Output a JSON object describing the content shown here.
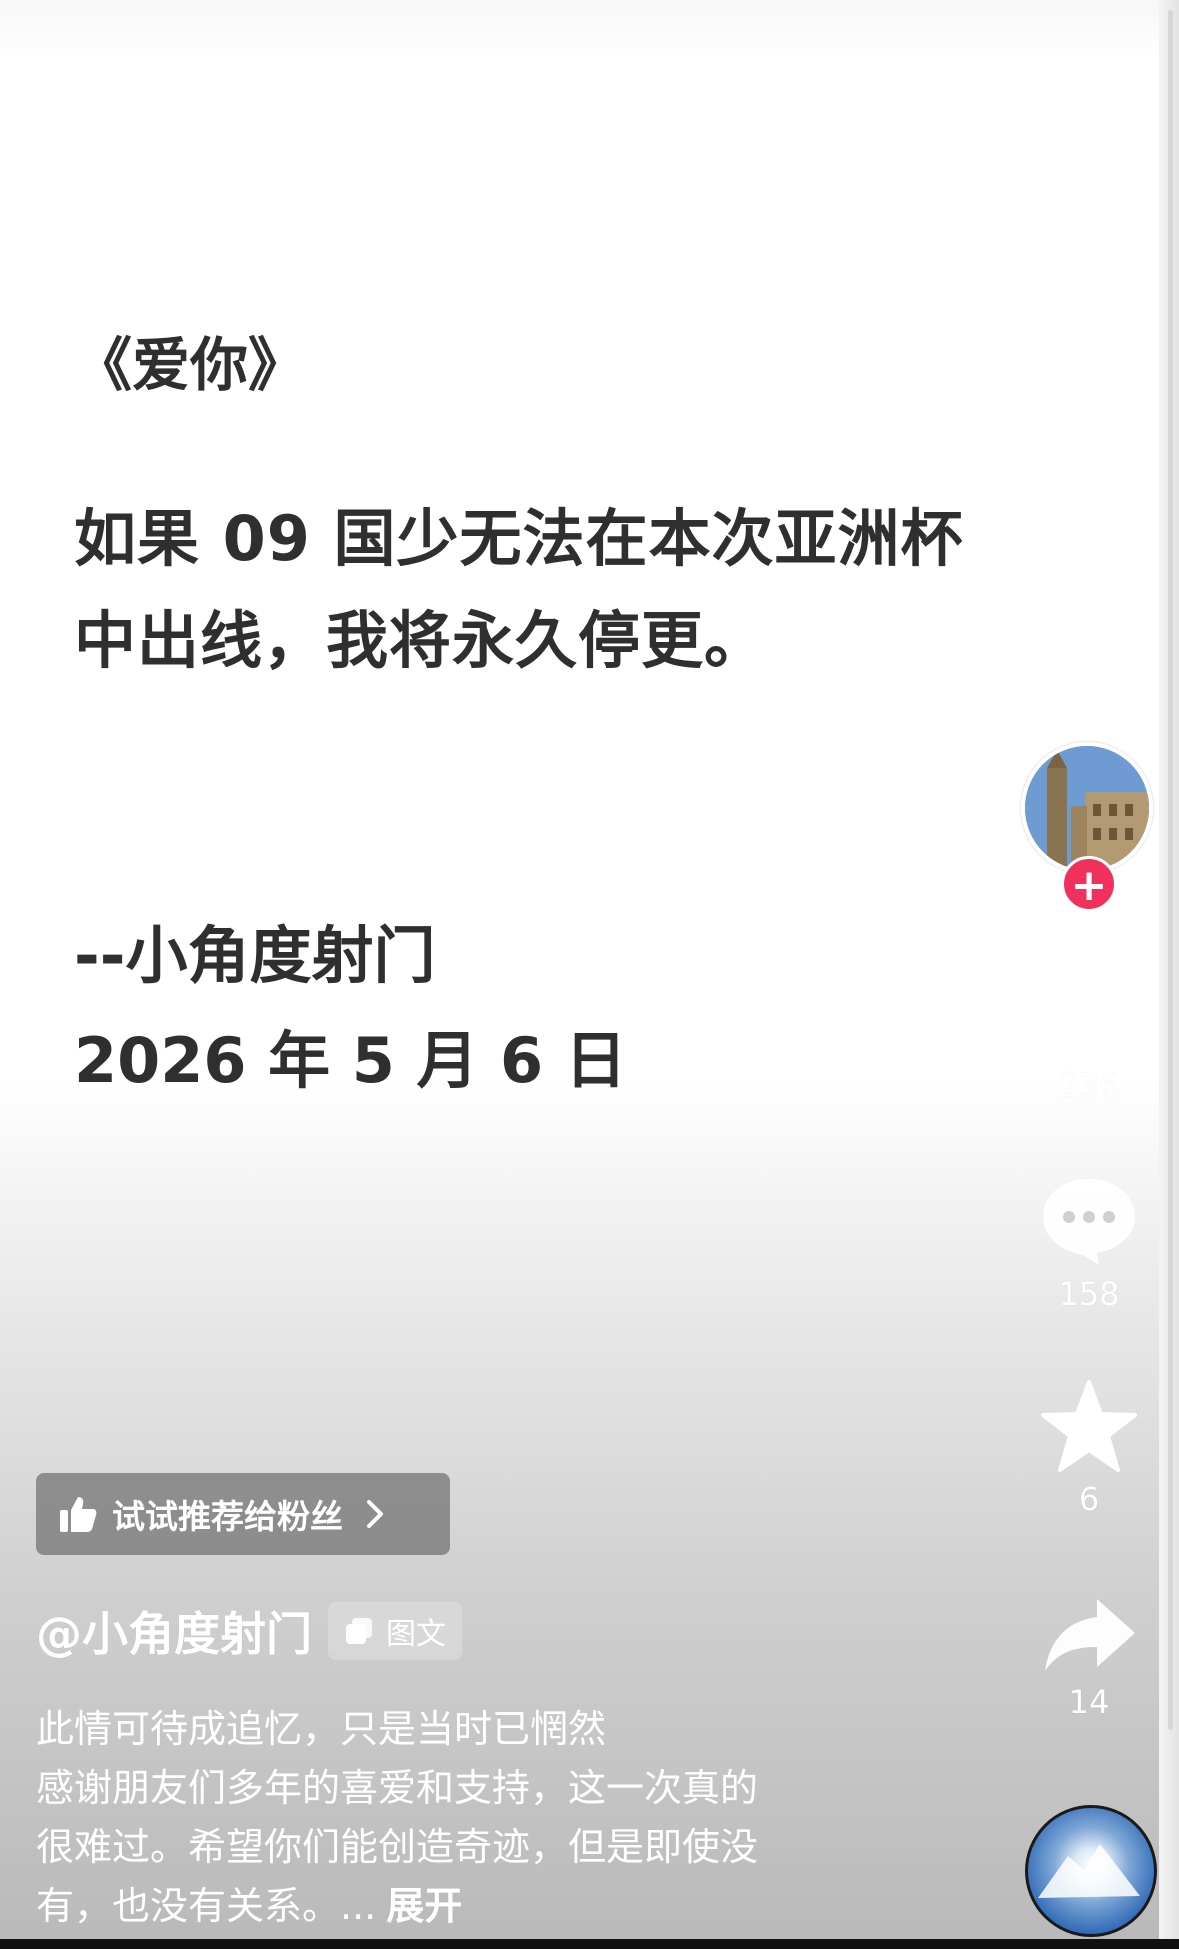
{
  "poem": {
    "title": "《爱你》",
    "line1": "如果 09 国少无法在本次亚洲杯",
    "line2": "中出线，我将永久停更。",
    "signature": "--小角度射门",
    "date": "2026 年 5 月 6 日"
  },
  "actions": {
    "likes": "236",
    "comments": "158",
    "favorites": "6",
    "shares": "14"
  },
  "recommend": {
    "label": "试试推荐给粉丝"
  },
  "author": {
    "name": "@小角度射门",
    "type_badge": "图文"
  },
  "description": {
    "line1": "此情可待成追忆，只是当时已惘然",
    "line2": "感谢朋友们多年的喜爱和支持，这一次真的",
    "line3": "很难过。希望你们能创造奇迹，但是即使没",
    "line4": "有，也没有关系。...",
    "expand": "展开"
  },
  "colors": {
    "follow_button": "#f0315b",
    "poem_text": "#2f2f2f"
  },
  "icons": [
    "thumbs-up-icon",
    "chevron-right-icon",
    "image-text-icon",
    "plus-icon",
    "heart-icon",
    "comment-icon",
    "star-icon",
    "share-icon"
  ]
}
